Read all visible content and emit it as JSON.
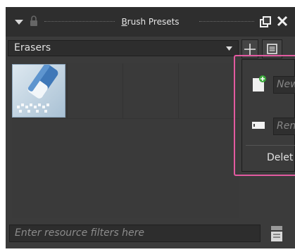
{
  "panel": {
    "title_underlined": "B",
    "title_rest": "rush Presets",
    "icons": {
      "collapse": "chevron-down-icon",
      "lock": "lock-icon",
      "float": "float-window-icon",
      "close": "close-icon"
    }
  },
  "preset_selector": {
    "value": "Erasers"
  },
  "toolbar": {
    "add_icon": "plus-icon",
    "menu_icon": "list-menu-icon"
  },
  "presets": [
    {
      "name": "Eraser",
      "icon": "eraser-icon"
    }
  ],
  "popup_menu": {
    "new_placeholder": "New",
    "rename_placeholder": "Ren",
    "delete_label": "Delet"
  },
  "filter": {
    "placeholder": "Enter resource filters here",
    "menu_icon": "filter-menu-icon"
  },
  "colors": {
    "panel_bg": "#3b3b3b",
    "highlight": "#e25aa0",
    "thumb_bg": "#c7d8e4"
  }
}
